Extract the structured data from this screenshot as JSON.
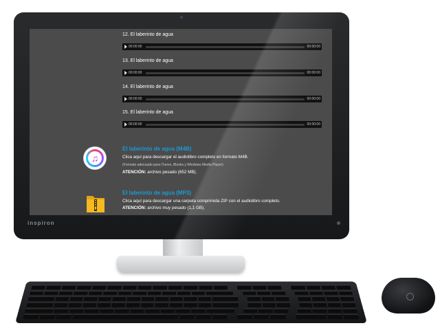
{
  "device": {
    "brand": "inspiron"
  },
  "tracks": [
    {
      "title": "12. El laberinto de agua",
      "current_time": "00:00:00",
      "duration": "00:00:00"
    },
    {
      "title": "13. El laberinto de agua",
      "current_time": "00:00:00",
      "duration": "00:00:00"
    },
    {
      "title": "14. El laberinto de agua",
      "current_time": "00:00:00",
      "duration": "00:00:00"
    },
    {
      "title": "15. El laberinto de agua",
      "current_time": "00:00:00",
      "duration": "00:00:00"
    }
  ],
  "downloads": {
    "m4b": {
      "title": "El laberinto de agua (M4B)",
      "description": "Clica aquí para descargar el audiolibro completo en formato M4B.",
      "note": "(Formato adecuado para iTunes, iBooks y Windows Media Player)",
      "warning_label": "ATENCIÓN:",
      "warning_text": " archivo pesado (652 MB).",
      "icon": "itunes-icon"
    },
    "mp3": {
      "title": "El laberinto de agua (MP3)",
      "description": "Clica aquí para descargar una carpeta comprimida ZIP con el audiolibro completo.",
      "warning_label": "ATENCIÓN:",
      "warning_text": " archivo muy pesado (1,1 GB).",
      "icon": "zip-folder-icon"
    }
  },
  "colors": {
    "screen_bg": "#4b4b4b",
    "link_blue": "#1a9ad6",
    "player_bg": "#111111"
  }
}
